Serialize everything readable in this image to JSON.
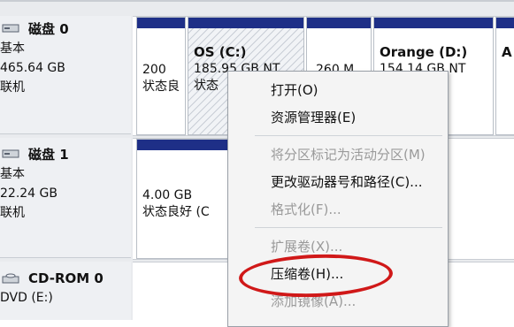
{
  "disks": [
    {
      "title": "磁盘 0",
      "type": "基本",
      "size": "465.64 GB",
      "status": "联机",
      "partitions": [
        {
          "line1": "200",
          "line2": "状态良"
        },
        {
          "name": "OS  (C:)",
          "line1": "185.95 GB NT",
          "line2": "状态"
        },
        {
          "line1": "260 M"
        },
        {
          "name": "Orange  (D:)",
          "line1": "154.14 GB NT"
        },
        {
          "name": "A"
        }
      ]
    },
    {
      "title": "磁盘 1",
      "type": "基本",
      "size": "22.24 GB",
      "status": "联机",
      "partitions": [
        {
          "line1": "4.00 GB",
          "line2": "状态良好 (C"
        }
      ]
    },
    {
      "title": "CD-ROM 0",
      "type": "DVD (E:)"
    }
  ],
  "context_menu": {
    "items": [
      {
        "label": "打开(O)",
        "enabled": true
      },
      {
        "label": "资源管理器(E)",
        "enabled": true
      },
      {
        "label": "将分区标记为活动分区(M)",
        "enabled": false
      },
      {
        "label": "更改驱动器号和路径(C)...",
        "enabled": true
      },
      {
        "label": "格式化(F)...",
        "enabled": false
      },
      {
        "label": "扩展卷(X)...",
        "enabled": false
      },
      {
        "label": "压缩卷(H)...",
        "enabled": true
      },
      {
        "label": "添加镜像(A)...",
        "enabled": false
      }
    ]
  },
  "colors": {
    "partition_bar": "#1e2f87",
    "highlight_ellipse": "#d01818"
  }
}
